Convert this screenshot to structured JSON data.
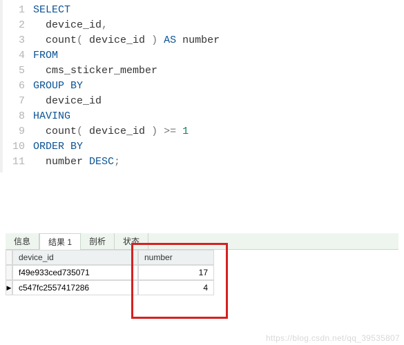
{
  "code": {
    "lines": [
      {
        "n": "1",
        "html": "<span class=\"kw\">SELECT</span>"
      },
      {
        "n": "2",
        "html": "  device_id<span class=\"op\">,</span>"
      },
      {
        "n": "3",
        "html": "  count<span class=\"op\">(</span> device_id <span class=\"op\">)</span> <span class=\"kw\">AS</span> number"
      },
      {
        "n": "4",
        "html": "<span class=\"kw\">FROM</span>"
      },
      {
        "n": "5",
        "html": "  cms_sticker_member"
      },
      {
        "n": "6",
        "html": "<span class=\"kw\">GROUP</span> <span class=\"kw\">BY</span>"
      },
      {
        "n": "7",
        "html": "  device_id"
      },
      {
        "n": "8",
        "html": "<span class=\"kw\">HAVING</span>"
      },
      {
        "n": "9",
        "html": "  count<span class=\"op\">(</span> device_id <span class=\"op\">)</span> <span class=\"op\">&gt;=</span> <span class=\"num\">1</span>"
      },
      {
        "n": "10",
        "html": "<span class=\"kw\">ORDER</span> <span class=\"kw\">BY</span>"
      },
      {
        "n": "11",
        "html": "  number <span class=\"kw\">DESC</span><span class=\"op\">;</span>"
      }
    ]
  },
  "tabs": {
    "items": [
      {
        "label": "信息",
        "active": false
      },
      {
        "label": "结果 1",
        "active": true
      },
      {
        "label": "剖析",
        "active": false
      },
      {
        "label": "状态",
        "active": false
      }
    ]
  },
  "grid": {
    "columns": [
      "device_id",
      "number"
    ],
    "rows": [
      {
        "marker": "",
        "device_id": "f49e933ced735071",
        "number": "17"
      },
      {
        "marker": "▶",
        "device_id": "c547fc2557417286",
        "number": "4"
      }
    ]
  },
  "watermark": "https://blog.csdn.net/qq_39535807"
}
